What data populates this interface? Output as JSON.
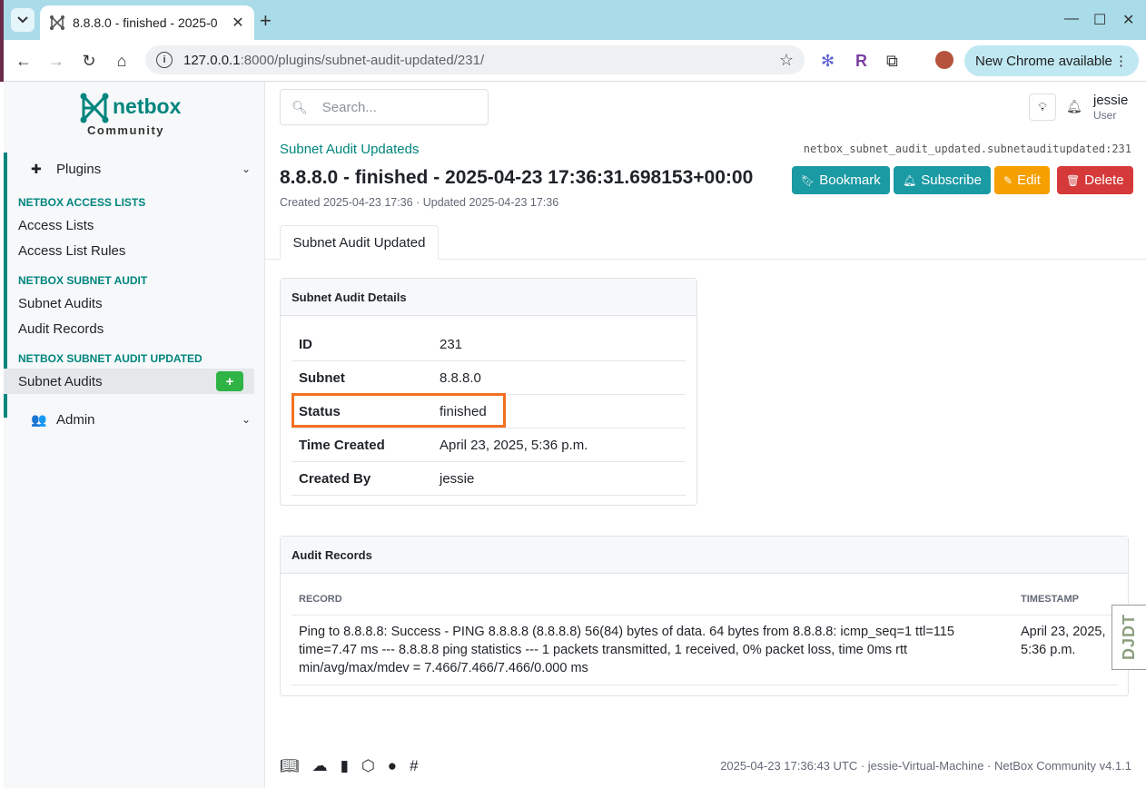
{
  "browser": {
    "tab_title": "8.8.8.0 - finished - 2025-0",
    "url_host": "127.0.0.1",
    "url_rest": ":8000/plugins/subnet-audit-updated/231/",
    "update_label": "New Chrome available"
  },
  "sidebar": {
    "logo_word": "netbox",
    "logo_sub": "Community",
    "plugins_label": "Plugins",
    "groups": [
      {
        "title": "NETBOX ACCESS LISTS",
        "items": [
          "Access Lists",
          "Access List Rules"
        ]
      },
      {
        "title": "NETBOX SUBNET AUDIT",
        "items": [
          "Subnet Audits",
          "Audit Records"
        ]
      },
      {
        "title": "NETBOX SUBNET AUDIT UPDATED",
        "items": [
          "Subnet Audits"
        ]
      }
    ],
    "admin_label": "Admin"
  },
  "header": {
    "search_placeholder": "Search...",
    "user_name": "jessie",
    "user_role": "User"
  },
  "object": {
    "breadcrumb": "Subnet Audit Updateds",
    "path": "netbox_subnet_audit_updated.subnetauditupdated:231",
    "title": "8.8.8.0 - finished - 2025-04-23 17:36:31.698153+00:00",
    "meta": "Created 2025-04-23 17:36 · Updated 2025-04-23 17:36",
    "buttons": {
      "bookmark": "Bookmark",
      "subscribe": "Subscribe",
      "edit": "Edit",
      "delete": "Delete"
    },
    "tab": "Subnet Audit Updated"
  },
  "details": {
    "title": "Subnet Audit Details",
    "rows": [
      {
        "key": "ID",
        "value": "231"
      },
      {
        "key": "Subnet",
        "value": "8.8.8.0"
      },
      {
        "key": "Status",
        "value": "finished"
      },
      {
        "key": "Time Created",
        "value": "April 23, 2025, 5:36 p.m."
      },
      {
        "key": "Created By",
        "value": "jessie"
      }
    ]
  },
  "records": {
    "title": "Audit Records",
    "columns": [
      "RECORD",
      "TIMESTAMP"
    ],
    "rows": [
      {
        "record": "Ping to 8.8.8.8: Success - PING 8.8.8.8 (8.8.8.8) 56(84) bytes of data. 64 bytes from 8.8.8.8: icmp_seq=1 ttl=115 time=7.47 ms --- 8.8.8.8 ping statistics --- 1 packets transmitted, 1 received, 0% packet loss, time 0ms rtt min/avg/max/mdev = 7.466/7.466/7.466/0.000 ms",
        "timestamp": "April 23, 2025, 5:36 p.m."
      }
    ]
  },
  "footer": {
    "text": "2025-04-23 17:36:43 UTC · jessie-Virtual-Machine · NetBox Community v4.1.1"
  },
  "djdt": "DJDT",
  "colors": {
    "accent": "#00857d",
    "highlight": "#f37021"
  }
}
